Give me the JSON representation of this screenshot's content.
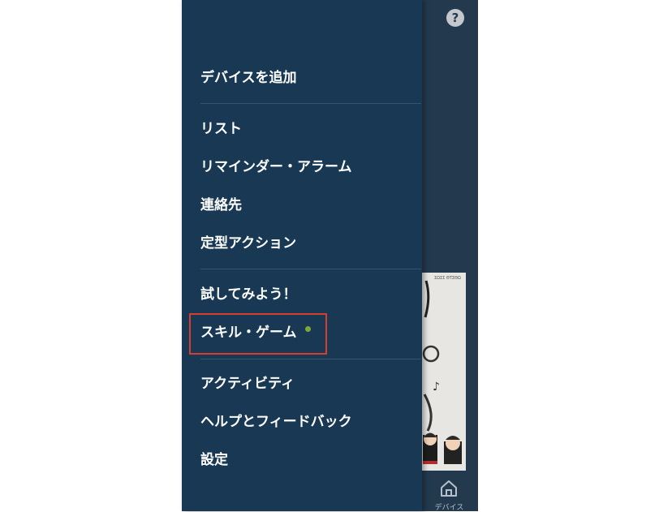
{
  "menu": {
    "add_device": "デバイスを追加",
    "lists": "リスト",
    "reminders_alarms": "リマインダー・アラーム",
    "contacts": "連絡先",
    "routines": "定型アクション",
    "things_to_try": "試してみよう！",
    "skills_games": "スキル・ゲーム",
    "activity": "アクティビティ",
    "help_feedback": "ヘルプとフィードバック",
    "settings": "設定"
  },
  "header": {
    "help_icon_glyph": "?"
  },
  "background_card": {
    "text": "ΣΩΣΣ ΘΤΣΘΩ"
  },
  "bottom_nav": {
    "devices_label": "デバイス"
  },
  "colors": {
    "drawer_bg": "#183853",
    "app_bg": "#233a4e",
    "new_badge": "#7da836",
    "highlight_border": "#d63f2f"
  },
  "icons": {
    "help": "help-icon",
    "home": "home-icon",
    "new_badge": "new-dot"
  }
}
